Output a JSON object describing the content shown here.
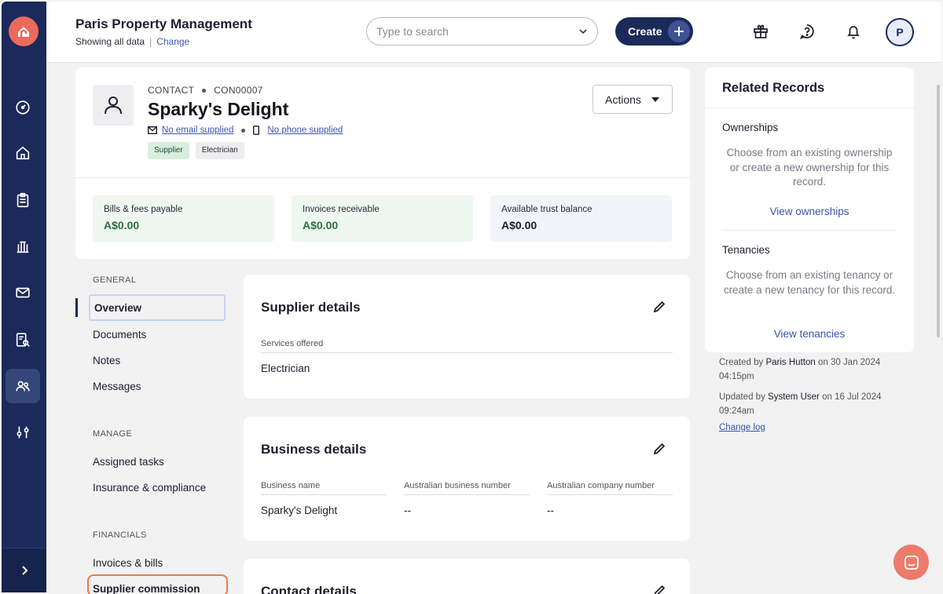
{
  "header": {
    "org_title": "Paris Property Management",
    "org_subtitle": "Showing all data",
    "change_link": "Change",
    "search_placeholder": "Type to search",
    "create_label": "Create",
    "avatar_initial": "P"
  },
  "contact": {
    "type_label": "CONTACT",
    "id": "CON00007",
    "name": "Sparky's Delight",
    "email": "No email supplied",
    "phone": "No phone supplied",
    "tags": [
      "Supplier",
      "Electrician"
    ],
    "actions_label": "Actions"
  },
  "stats": [
    {
      "label": "Bills & fees payable",
      "value": "A$0.00"
    },
    {
      "label": "Invoices receivable",
      "value": "A$0.00"
    },
    {
      "label": "Available trust balance",
      "value": "A$0.00"
    }
  ],
  "subnav": {
    "general_heading": "GENERAL",
    "general": [
      "Overview",
      "Documents",
      "Notes",
      "Messages"
    ],
    "manage_heading": "MANAGE",
    "manage": [
      "Assigned tasks",
      "Insurance & compliance"
    ],
    "financials_heading": "FINANCIALS",
    "financials": [
      "Invoices & bills",
      "Supplier commission"
    ]
  },
  "supplier_details": {
    "title": "Supplier details",
    "services_label": "Services offered",
    "services_value": "Electrician"
  },
  "business_details": {
    "title": "Business details",
    "fields": [
      {
        "label": "Business name",
        "value": "Sparky's Delight"
      },
      {
        "label": "Australian business number",
        "value": "--"
      },
      {
        "label": "Australian company number",
        "value": "--"
      }
    ]
  },
  "contact_details": {
    "title": "Contact details"
  },
  "related": {
    "title": "Related Records",
    "ownerships_title": "Ownerships",
    "ownerships_desc": "Choose from an existing ownership or create a new ownership for this record.",
    "ownerships_link": "View ownerships",
    "tenancies_title": "Tenancies",
    "tenancies_desc": "Choose from an existing tenancy or create a new tenancy for this record.",
    "tenancies_link": "View tenancies"
  },
  "audit": {
    "created_prefix": "Created by",
    "created_user": "Paris Hutton",
    "created_on": "on 30 Jan 2024 04:15pm",
    "updated_prefix": "Updated by",
    "updated_user": "System User",
    "updated_on": "on 16 Jul 2024 09:24am",
    "change_log": "Change log"
  },
  "colors": {
    "sidebar": "#1b2a5a",
    "brand": "#ea6a5b",
    "link": "#3b55b0",
    "positive": "#2c6e3f"
  }
}
